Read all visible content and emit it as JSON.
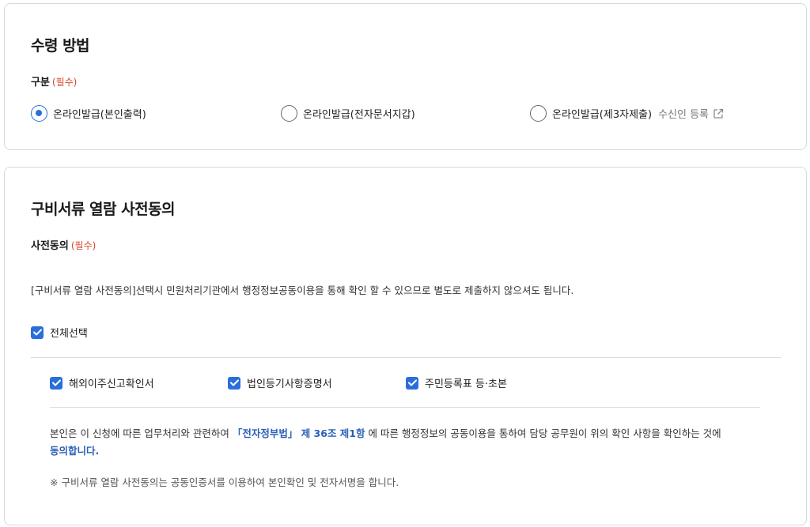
{
  "receipt": {
    "title": "수령 방법",
    "field_label": "구분",
    "required": "(필수)",
    "options": [
      {
        "label": "온라인발급(본인출력)",
        "checked": true
      },
      {
        "label": "온라인발급(전자문서지갑)",
        "checked": false
      },
      {
        "label": "온라인발급(제3자제출)",
        "checked": false
      }
    ],
    "recipient_link": "수신인 등록"
  },
  "consent": {
    "title": "구비서류 열람 사전동의",
    "field_label": "사전동의",
    "required": "(필수)",
    "description": "[구비서류 열람 사전동의]선택시 민원처리기관에서 행정정보공동이용을 통해 확인 할 수 있으므로 별도로 제출하지 않으셔도 됩니다.",
    "select_all": "전체선택",
    "items": [
      {
        "label": "해외이주신고확인서",
        "checked": true
      },
      {
        "label": "법인등기사항증명서",
        "checked": true
      },
      {
        "label": "주민등록표 등·초본",
        "checked": true
      }
    ],
    "agreement": {
      "prefix": "본인은 이 신청에 따른 업무처리와 관련하여 ",
      "law": "「전자정부법」 제 36조 제1항",
      "middle": " 에 따른 행정정보의 공동이용을 통하여 담당 공무원이 위의 확인 사항을 확인하는 것에",
      "agree": "동의합니다."
    },
    "note": "※ 구비서류 열람 사전동의는 공동인증서를 이용하여 본인확인 및 전자서명을 합니다."
  },
  "colors": {
    "accent": "#2a6edb",
    "required": "#d8472a",
    "link_emphasis": "#2a5fb8",
    "border": "#d9d9d9"
  },
  "icons": {
    "external_link": "external-link-icon",
    "checkmark": "checkmark-icon"
  }
}
